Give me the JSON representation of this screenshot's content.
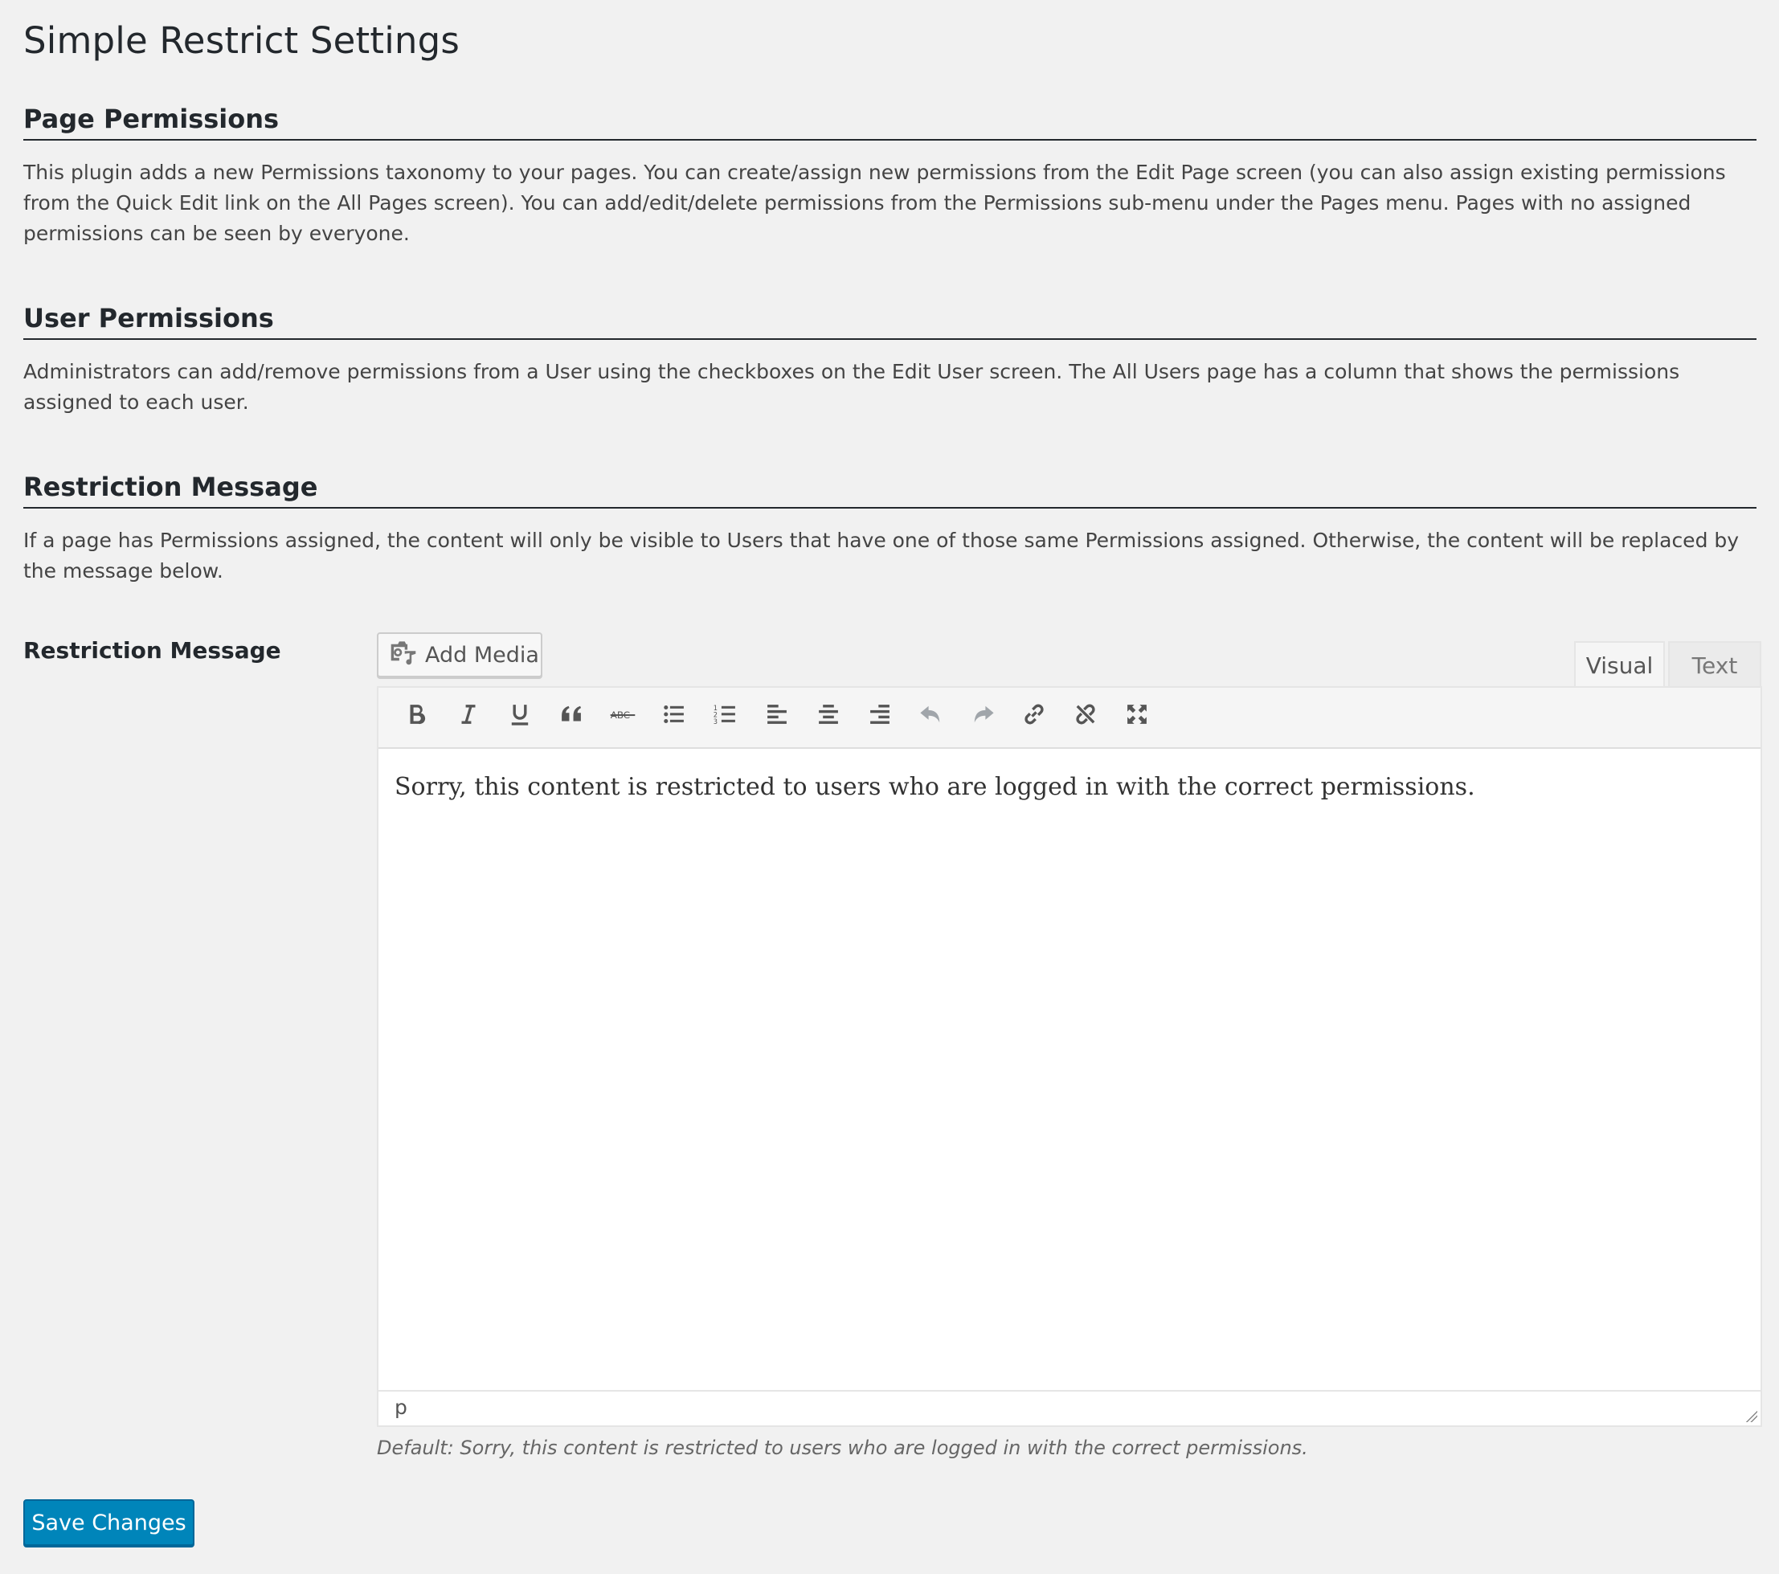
{
  "page_title": "Simple Restrict Settings",
  "sections": [
    {
      "title": "Page Permissions",
      "description": "This plugin adds a new Permissions taxonomy to your pages. You can create/assign new permissions from the Edit Page screen (you can also assign existing permissions from the Quick Edit link on the All Pages screen). You can add/edit/delete permissions from the Permissions sub-menu under the Pages menu. Pages with no assigned permissions can be seen by everyone."
    },
    {
      "title": "User Permissions",
      "description": "Administrators can add/remove permissions from a User using the checkboxes on the Edit User screen. The All Users page has a column that shows the permissions assigned to each user."
    },
    {
      "title": "Restriction Message",
      "description": "If a page has Permissions assigned, the content will only be visible to Users that have one of those same Permissions assigned. Otherwise, the content will be replaced by the message below."
    }
  ],
  "field": {
    "label": "Restriction Message",
    "add_media_label": "Add Media",
    "tabs": {
      "visual": "Visual",
      "text": "Text"
    },
    "content": "Sorry, this content is restricted to users who are logged in with the correct permissions.",
    "status_path": "p",
    "description": "Default: Sorry, this content is restricted to users who are logged in with the correct permissions."
  },
  "toolbar_icons": [
    "bold-icon",
    "italic-icon",
    "underline-icon",
    "blockquote-icon",
    "strikethrough-icon",
    "bullet-list-icon",
    "numbered-list-icon",
    "align-left-icon",
    "align-center-icon",
    "align-right-icon",
    "undo-icon",
    "redo-icon",
    "link-icon",
    "unlink-icon",
    "fullscreen-icon"
  ],
  "save_label": "Save Changes",
  "colors": {
    "primary_button": "#0085ba",
    "background": "#f1f1f1"
  }
}
